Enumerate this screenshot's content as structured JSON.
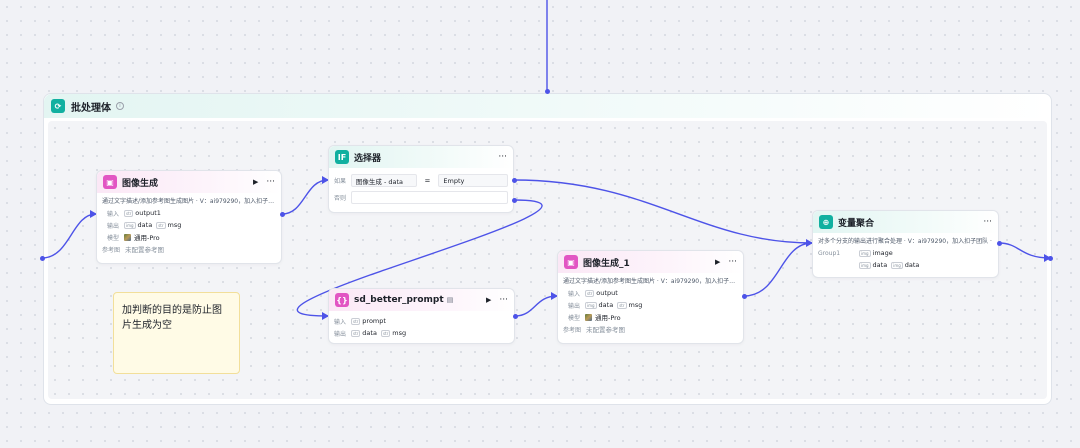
{
  "batch": {
    "title": "批处理体"
  },
  "labels": {
    "input": "输入",
    "output": "输出",
    "model": "模型",
    "ref": "参考图",
    "if": "如果",
    "else": "否则"
  },
  "nodes": {
    "image_gen": {
      "title": "图像生成",
      "desc": "通过文字描述/添加参考图生成图片 · V：ai979290，加入扣子…",
      "input": "output1",
      "outputs": [
        "data",
        "msg"
      ],
      "model": "通用-Pro",
      "ref": "未配置参考图"
    },
    "selector": {
      "title": "选择器",
      "if_left": "图像生成 - data",
      "if_op": "=",
      "if_right": "Empty"
    },
    "sd_prompt": {
      "title": "sd_better_prompt",
      "input": "prompt",
      "outputs": [
        "data",
        "msg"
      ]
    },
    "image_gen_1": {
      "title": "图像生成_1",
      "desc": "通过文字描述/添加参考图生成图片 · V：ai979290，加入扣子…",
      "input": "output",
      "outputs": [
        "data",
        "msg"
      ],
      "model": "通用-Pro",
      "ref": "未配置参考图"
    },
    "var_agg": {
      "title": "变量聚合",
      "desc": "对多个分支的输出进行聚合处理 · V：ai979290，加入扣子团队 ·",
      "group_label": "Group1",
      "group_var": "image",
      "items": [
        "data",
        "data"
      ]
    }
  },
  "note": {
    "text": "加判断的目的是防止图片生成为空"
  },
  "colors": {
    "wire": "#4d53e8",
    "teal": "#11b0a0",
    "pink": "#e255c3",
    "note_bg": "#fffbe6"
  },
  "icons": {
    "batch": "batch-loop-icon",
    "image": "image-gen-icon",
    "selector": "if-selector-icon",
    "prompt": "prompt-code-icon",
    "aggregate": "variable-aggregate-icon"
  }
}
